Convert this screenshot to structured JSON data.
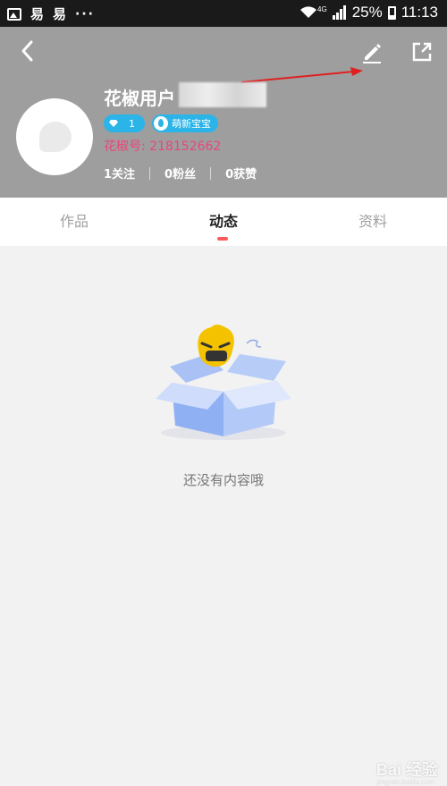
{
  "status_bar": {
    "icons_left": [
      "image-icon",
      "app-notification-icon",
      "app-notification-icon",
      "more-dots-icon"
    ],
    "glyph_a": "易",
    "glyph_b": "易",
    "dots": "···",
    "battery_percent": "25%",
    "time": "11:13",
    "network": "4G"
  },
  "header": {
    "username": "花椒用户",
    "level": "1",
    "title_badge": "萌新宝宝",
    "huajiao_id": "花椒号: 218152662",
    "stats": {
      "following": "1关注",
      "fans": "0粉丝",
      "likes": "0获赞"
    },
    "colors": {
      "background": "#9e9e9e",
      "id_text": "#e8477a",
      "badge": "#2ab4e8"
    }
  },
  "tabs": [
    {
      "label": "作品",
      "active": false
    },
    {
      "label": "动态",
      "active": true
    },
    {
      "label": "资料",
      "active": false
    }
  ],
  "empty_state": {
    "message": "还没有内容哦",
    "illustration": "empty-box-mascot"
  },
  "watermark": {
    "text": "Bai 经验",
    "sub": "jingyan.baidu.com"
  }
}
